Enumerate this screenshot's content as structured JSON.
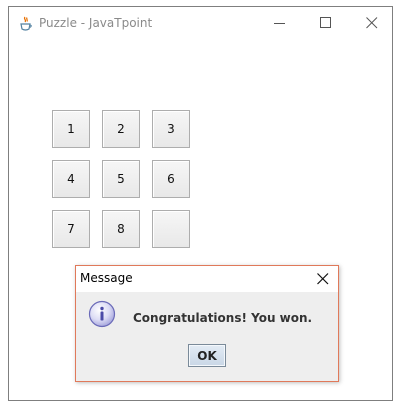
{
  "window": {
    "title": "Puzzle - JavaTpoint",
    "icons": {
      "app": "java-coffee-cup-icon",
      "minimize": "minimize-icon",
      "maximize": "maximize-icon",
      "close": "close-icon"
    }
  },
  "puzzle": {
    "tiles": [
      {
        "label": "1"
      },
      {
        "label": "2"
      },
      {
        "label": "3"
      },
      {
        "label": "4"
      },
      {
        "label": "5"
      },
      {
        "label": "6"
      },
      {
        "label": "7"
      },
      {
        "label": "8"
      },
      {
        "label": ""
      }
    ]
  },
  "dialog": {
    "title": "Message",
    "message": "Congratulations! You won.",
    "ok_label": "OK",
    "icon": "info-icon",
    "accent_border": "#e0795a"
  }
}
